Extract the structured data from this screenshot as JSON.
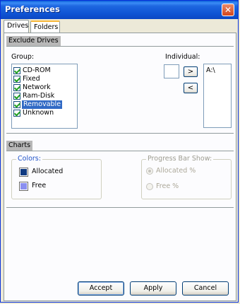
{
  "window": {
    "title": "Preferences",
    "close_icon": "close-icon"
  },
  "tabs": [
    {
      "label": "Drives"
    },
    {
      "label": "Folders"
    }
  ],
  "exclude_drives": {
    "header": "Exclude Drives",
    "group_label": "Group:",
    "individual_label": "Individual:",
    "groups": [
      {
        "label": "CD-ROM",
        "checked": true
      },
      {
        "label": "Fixed",
        "checked": true
      },
      {
        "label": "Network",
        "checked": true
      },
      {
        "label": "Ram-Disk",
        "checked": true
      },
      {
        "label": "Removable",
        "checked": true,
        "selected": true
      },
      {
        "label": "Unknown",
        "checked": true
      }
    ],
    "add_button": ">",
    "remove_button": "<",
    "individual_items": [
      "A:\\"
    ]
  },
  "charts": {
    "header": "Charts",
    "colors_title": "Colors:",
    "colors": [
      {
        "label": "Allocated",
        "color": "#103a82"
      },
      {
        "label": "Free",
        "color": "#8a8ff0"
      }
    ],
    "progress_title": "Progress Bar Show:",
    "progress_options": [
      {
        "label": "Allocated %",
        "checked": true
      },
      {
        "label": "Free %",
        "checked": false
      }
    ]
  },
  "buttons": {
    "accept": "Accept",
    "apply": "Apply",
    "cancel": "Cancel"
  }
}
